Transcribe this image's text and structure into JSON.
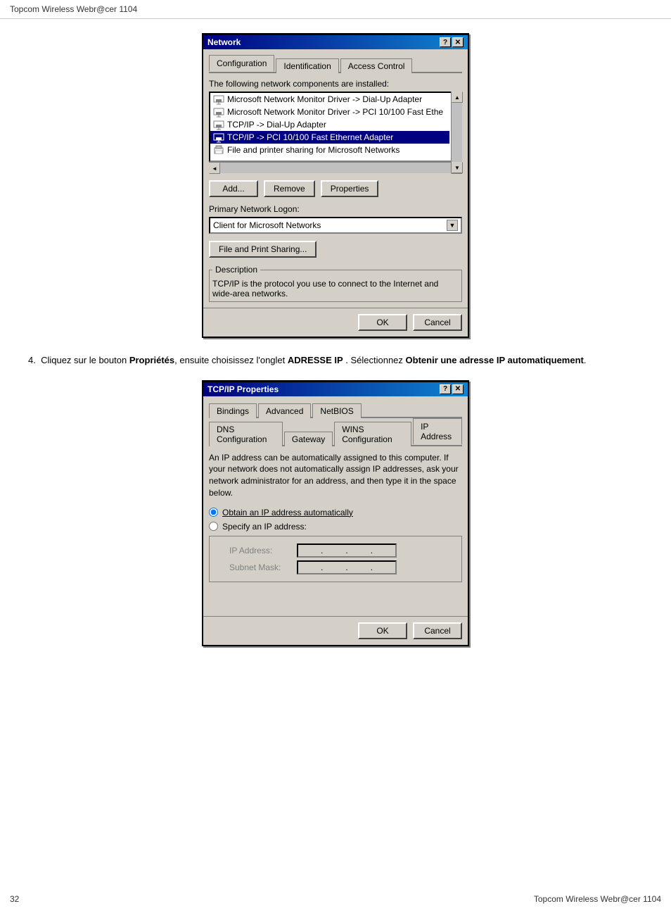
{
  "header": {
    "title": "Topcom Wireless Webr@cer 1104"
  },
  "footer": {
    "page_number": "32",
    "title": "Topcom Wireless Webr@cer 1104"
  },
  "network_dialog": {
    "title": "Network",
    "tabs": [
      "Configuration",
      "Identification",
      "Access Control"
    ],
    "active_tab": "Configuration",
    "list_label": "The following network components are installed:",
    "list_items": [
      "Microsoft Network Monitor Driver -> Dial-Up Adapter",
      "Microsoft Network Monitor Driver -> PCI 10/100 Fast Ethe",
      "TCP/IP -> Dial-Up Adapter",
      "TCP/IP -> PCI 10/100 Fast Ethernet Adapter",
      "File and printer sharing for Microsoft Networks"
    ],
    "selected_item_index": 3,
    "buttons": {
      "add": "Add...",
      "remove": "Remove",
      "properties": "Properties"
    },
    "primary_network_logon_label": "Primary Network Logon:",
    "primary_network_logon_value": "Client for Microsoft Networks",
    "file_sharing_btn": "File and Print Sharing...",
    "description_label": "Description",
    "description_text": "TCP/IP is the protocol you use to connect to the Internet and wide-area networks.",
    "ok_btn": "OK",
    "cancel_btn": "Cancel"
  },
  "step_4": {
    "number": "4.",
    "text_before": "Cliquez sur le bouton ",
    "bold1": "Propriétés",
    "text_mid1": ", ensuite choisissez l'onglet ",
    "bold2": "ADRESSE IP",
    "text_mid2": " . Sélectionnez ",
    "bold3": "Obtenir une adresse IP automatiquement",
    "text_end": "."
  },
  "tcpip_dialog": {
    "title": "TCP/IP Properties",
    "tabs_row1": [
      "Bindings",
      "Advanced",
      "NetBIOS"
    ],
    "tabs_row2": [
      "DNS Configuration",
      "Gateway",
      "WINS Configuration",
      "IP Address"
    ],
    "active_tab": "IP Address",
    "description": "An IP address can be automatically assigned to this computer. If your network does not automatically assign IP addresses, ask your network administrator for an address, and then type it in the space below.",
    "radio_auto": "Obtain an IP address automatically",
    "radio_specify": "Specify an IP address:",
    "ip_address_label": "IP Address:",
    "subnet_mask_label": "Subnet Mask:",
    "ok_btn": "OK",
    "cancel_btn": "Cancel"
  }
}
